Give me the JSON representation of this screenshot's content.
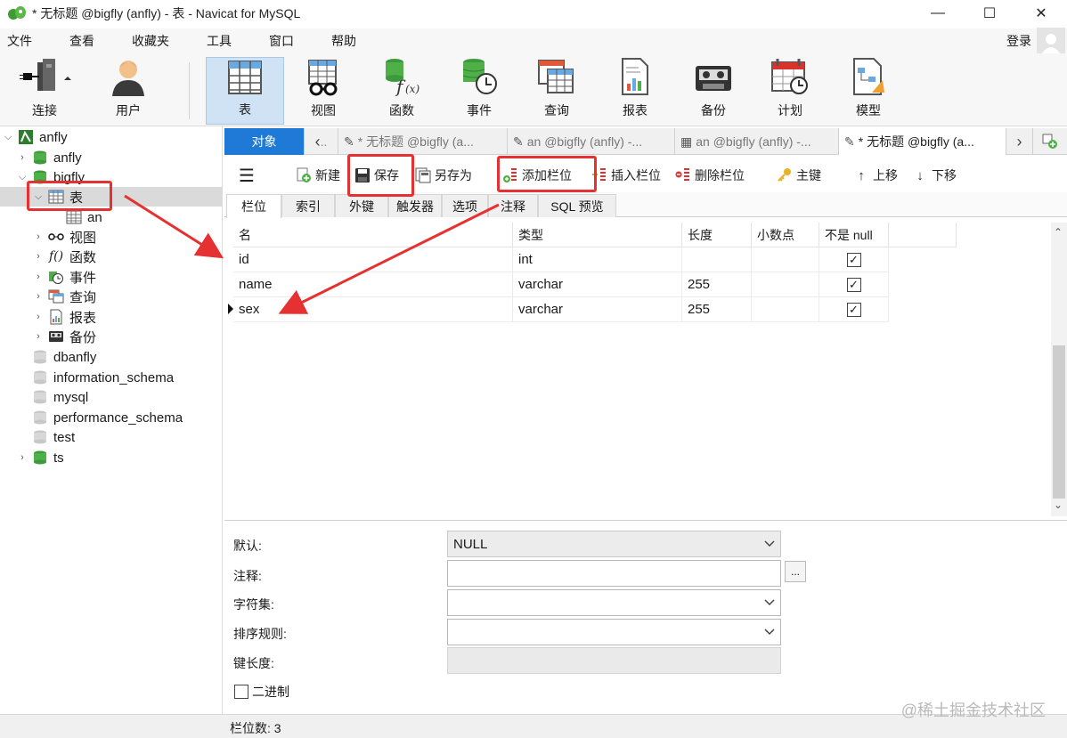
{
  "window": {
    "title": "* 无标题 @bigfly (anfly) - 表 - Navicat for MySQL",
    "controls": [
      "—",
      "☐",
      "✕"
    ]
  },
  "menu": [
    "文件",
    "查看",
    "收藏夹",
    "工具",
    "窗口",
    "帮助"
  ],
  "login_label": "登录",
  "toolbar": [
    "连接",
    "用户",
    "表",
    "视图",
    "函数",
    "事件",
    "查询",
    "报表",
    "备份",
    "计划",
    "模型"
  ],
  "tree": {
    "connection": "anfly",
    "databases_top": [
      "anfly",
      "bigfly"
    ],
    "tables_folder": "表",
    "table_item": "an",
    "bigfly_children": [
      "视图",
      "函数",
      "事件",
      "查询",
      "报表",
      "备份"
    ],
    "databases_bottom": [
      "dbanfly",
      "information_schema",
      "mysql",
      "performance_schema",
      "test",
      "ts"
    ]
  },
  "tabs": {
    "object": "对象",
    "docs": [
      "* 无标题 @bigfly (a...",
      "an @bigfly (anfly) -...",
      "an @bigfly (anfly) -...",
      "* 无标题 @bigfly (a..."
    ]
  },
  "subtoolbar": [
    "新建",
    "保存",
    "另存为",
    "添加栏位",
    "插入栏位",
    "删除栏位",
    "主键",
    "上移",
    "下移"
  ],
  "field_tabs": [
    "栏位",
    "索引",
    "外键",
    "触发器",
    "选项",
    "注释",
    "SQL 预览"
  ],
  "columns": [
    "名",
    "类型",
    "长度",
    "小数点",
    "不是 null"
  ],
  "rows": [
    {
      "name": "id",
      "type": "int",
      "length": "",
      "decimals": "",
      "not_null": true
    },
    {
      "name": "name",
      "type": "varchar",
      "length": "255",
      "decimals": "",
      "not_null": true
    },
    {
      "name": "sex",
      "type": "varchar",
      "length": "255",
      "decimals": "",
      "not_null": true
    }
  ],
  "properties": {
    "default_label": "默认:",
    "default_value": "NULL",
    "comment_label": "注释:",
    "charset_label": "字符集:",
    "collation_label": "排序规则:",
    "keylen_label": "键长度:",
    "binary_label": "二进制",
    "ellipsis": "..."
  },
  "status": "栏位数: 3",
  "watermark": "@稀土掘金技术社区",
  "accent_colors": {
    "object_tab": "#1f79d6",
    "highlight": "#e53131",
    "selected_toolbar": "#cfe3f5"
  }
}
